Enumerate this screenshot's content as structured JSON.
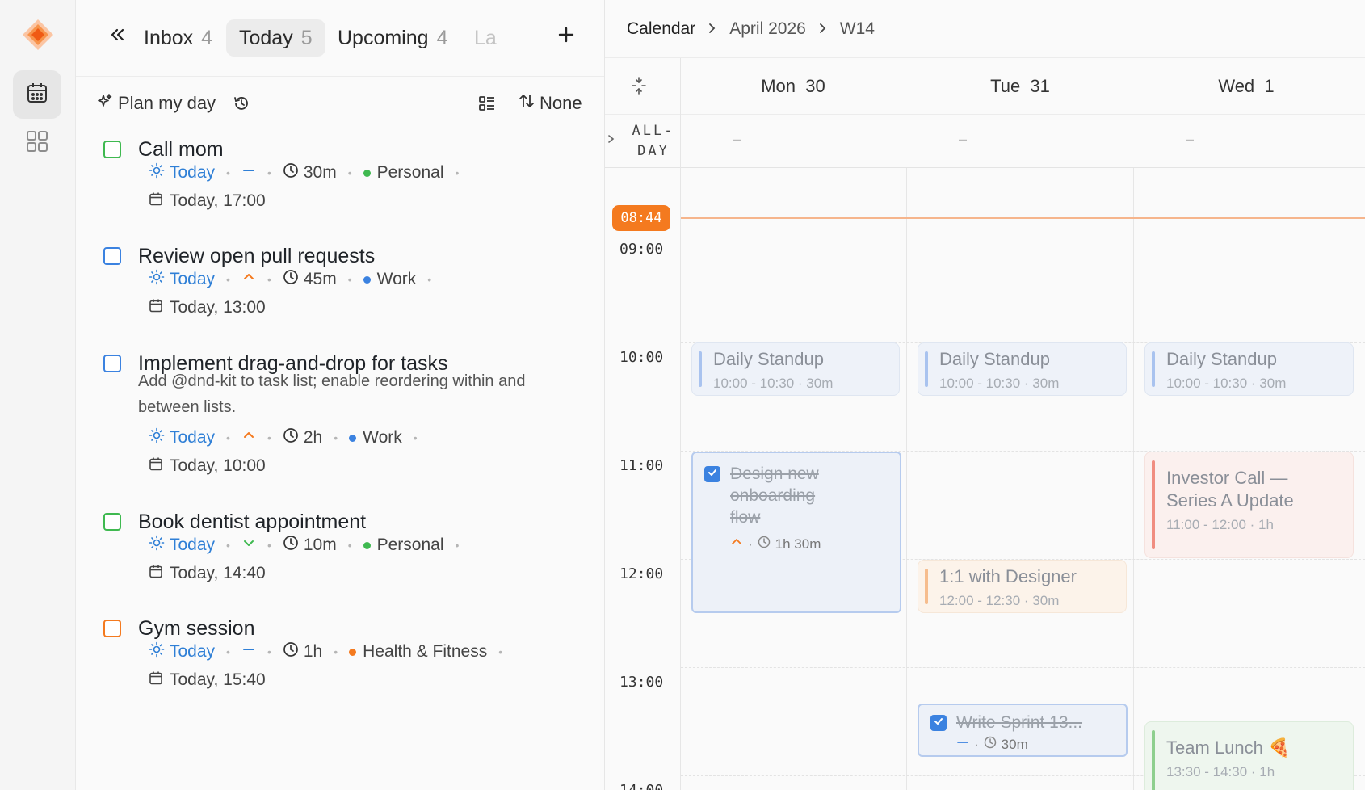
{
  "tabs": {
    "inbox": {
      "label": "Inbox",
      "count": "4"
    },
    "today": {
      "label": "Today",
      "count": "5"
    },
    "upcoming": {
      "label": "Upcoming",
      "count": "4"
    },
    "later": {
      "label": "La"
    }
  },
  "toolbar": {
    "plan_label": "Plan my day",
    "sort_label": "None"
  },
  "tasks": [
    {
      "title": "Call mom",
      "when": "Today",
      "duration": "30m",
      "project": "Personal",
      "due": "Today, 17:00",
      "checkbox_color": "#3fb950",
      "project_color": "#3fb950",
      "priority": "none"
    },
    {
      "title": "Review open pull requests",
      "when": "Today",
      "duration": "45m",
      "project": "Work",
      "due": "Today, 13:00",
      "checkbox_color": "#3b82e0",
      "project_color": "#3b82e0",
      "priority": "high"
    },
    {
      "title": "Implement drag-and-drop for tasks",
      "description": "Add @dnd-kit to task list; enable reordering within and between lists.",
      "when": "Today",
      "duration": "2h",
      "project": "Work",
      "due": "Today, 10:00",
      "checkbox_color": "#3b82e0",
      "project_color": "#3b82e0",
      "priority": "high"
    },
    {
      "title": "Book dentist appointment",
      "when": "Today",
      "duration": "10m",
      "project": "Personal",
      "due": "Today, 14:40",
      "checkbox_color": "#3fb950",
      "project_color": "#3fb950",
      "priority": "low"
    },
    {
      "title": "Gym session",
      "when": "Today",
      "duration": "1h",
      "project": "Health & Fitness",
      "due": "Today, 15:40",
      "checkbox_color": "#f47a1f",
      "project_color": "#f47a1f",
      "priority": "none"
    }
  ],
  "calendar": {
    "breadcrumb": [
      "Calendar",
      "April 2026",
      "W14"
    ],
    "days": [
      {
        "name": "Mon",
        "num": "30"
      },
      {
        "name": "Tue",
        "num": "31"
      },
      {
        "name": "Wed",
        "num": "1"
      }
    ],
    "allday_label_1": "ALL-",
    "allday_label_2": "DAY",
    "allday_empty": "–",
    "now": "08:44",
    "hours": [
      "09:00",
      "10:00",
      "11:00",
      "12:00",
      "13:00",
      "14:00"
    ],
    "events": {
      "standup_title": "Daily Standup",
      "standup_time": "10:00 - 10:30 · 30m",
      "investor_title_1": "Investor Call —",
      "investor_title_2": "Series A Update",
      "investor_time": "11:00 - 12:00 · 1h",
      "designer_title": "1:1 with Designer",
      "designer_time": "12:00 - 12:30 · 30m",
      "lunch_title": "Team Lunch 🍕",
      "lunch_time": "13:30 - 14:30 · 1h"
    },
    "task_blocks": {
      "design_1": "Design new",
      "design_2": "onboarding",
      "design_3": "flow",
      "design_duration": "1h 30m",
      "sprint_title": "Write Sprint 13...",
      "sprint_duration": "30m"
    }
  },
  "colors": {
    "accent": "#f47a1f",
    "link": "#2f7fd6",
    "check": "#3b82e0"
  }
}
